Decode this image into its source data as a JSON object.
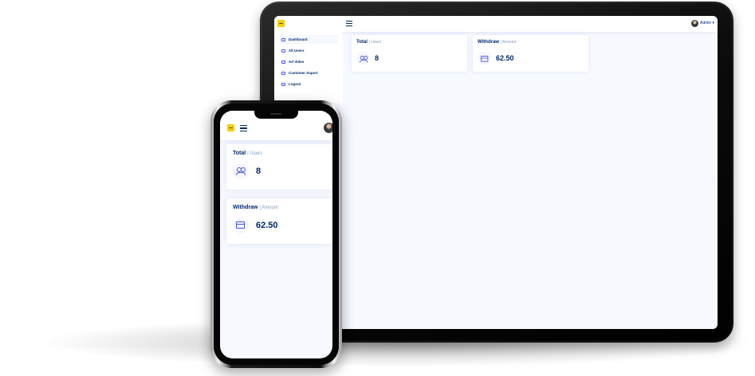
{
  "tablet": {
    "header": {
      "user_name": "Admin ▾"
    },
    "sidebar": {
      "items": [
        {
          "label": "Dashboard",
          "icon": "grid-icon",
          "active": true
        },
        {
          "label": "All Users",
          "icon": "person-icon",
          "active": false
        },
        {
          "label": "Ad Video",
          "icon": "video-icon",
          "active": false
        },
        {
          "label": "Customer Suport",
          "icon": "headset-icon",
          "active": false
        },
        {
          "label": "Logout",
          "icon": "logout-icon",
          "active": false
        }
      ]
    }
  },
  "cards": {
    "users": {
      "title": "Total",
      "subtitle": "| Users",
      "value": "8",
      "icon": "people-icon"
    },
    "withdraw": {
      "title": "Withdraw",
      "subtitle": "| Amount",
      "value": "62.50",
      "icon": "credit-card-icon"
    }
  },
  "colors": {
    "primary_text": "#012970",
    "accent": "#4154f1",
    "muted": "#899bbd",
    "background": "#f6f9ff",
    "logo": "#f5d000"
  }
}
